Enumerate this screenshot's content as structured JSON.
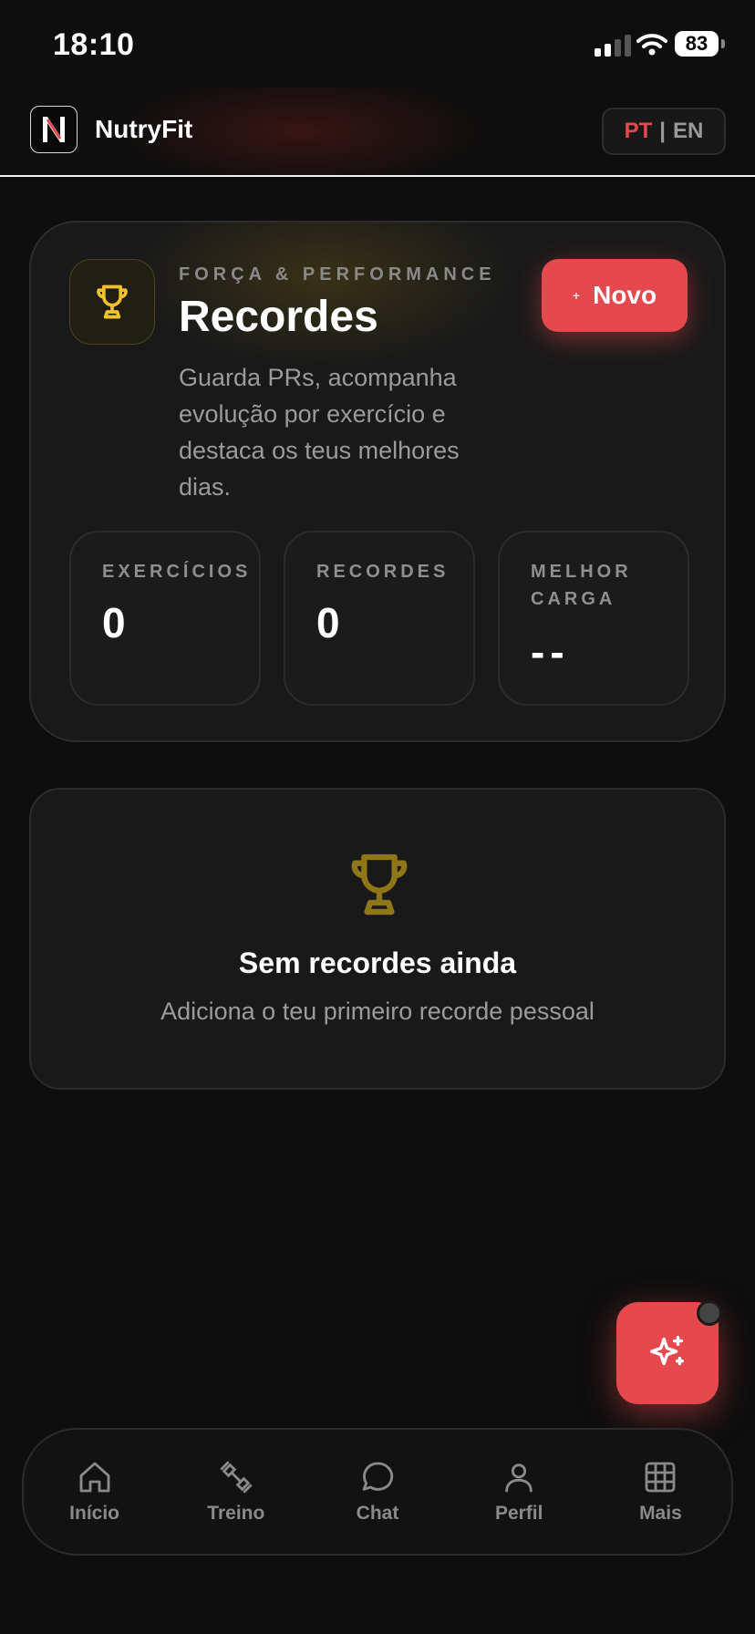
{
  "status_bar": {
    "time": "18:10",
    "battery": "83",
    "battery_level": 0.83
  },
  "header": {
    "app_name": "NutryFit",
    "logo_letter": "N",
    "lang_active": "PT",
    "lang_separator": "|",
    "lang_inactive": "EN"
  },
  "hero": {
    "eyebrow": "FORÇA & PERFORMANCE",
    "title": "Recordes",
    "description": "Guarda PRs, acompanha evolução por exercício e destaca os teus melhores dias.",
    "new_button_label": "Novo",
    "new_button_icon": "+",
    "stats": [
      {
        "label": "EXERCÍCIOS",
        "value": "0"
      },
      {
        "label": "RECORDES",
        "value": "0"
      },
      {
        "label": "MELHOR CARGA",
        "value": "--"
      }
    ]
  },
  "empty_state": {
    "title": "Sem recordes ainda",
    "subtitle": "Adiciona o teu primeiro recorde pessoal"
  },
  "bottom_nav": {
    "items": [
      {
        "label": "Início",
        "icon": "home-icon"
      },
      {
        "label": "Treino",
        "icon": "dumbbell-icon"
      },
      {
        "label": "Chat",
        "icon": "chat-icon"
      },
      {
        "label": "Perfil",
        "icon": "user-icon"
      },
      {
        "label": "Mais",
        "icon": "grid-icon"
      }
    ]
  },
  "colors": {
    "accent": "#e5484d",
    "gold": "#f2c12e",
    "background": "#0e0e0e",
    "card": "#191919",
    "muted_text": "#9b9b9b"
  }
}
